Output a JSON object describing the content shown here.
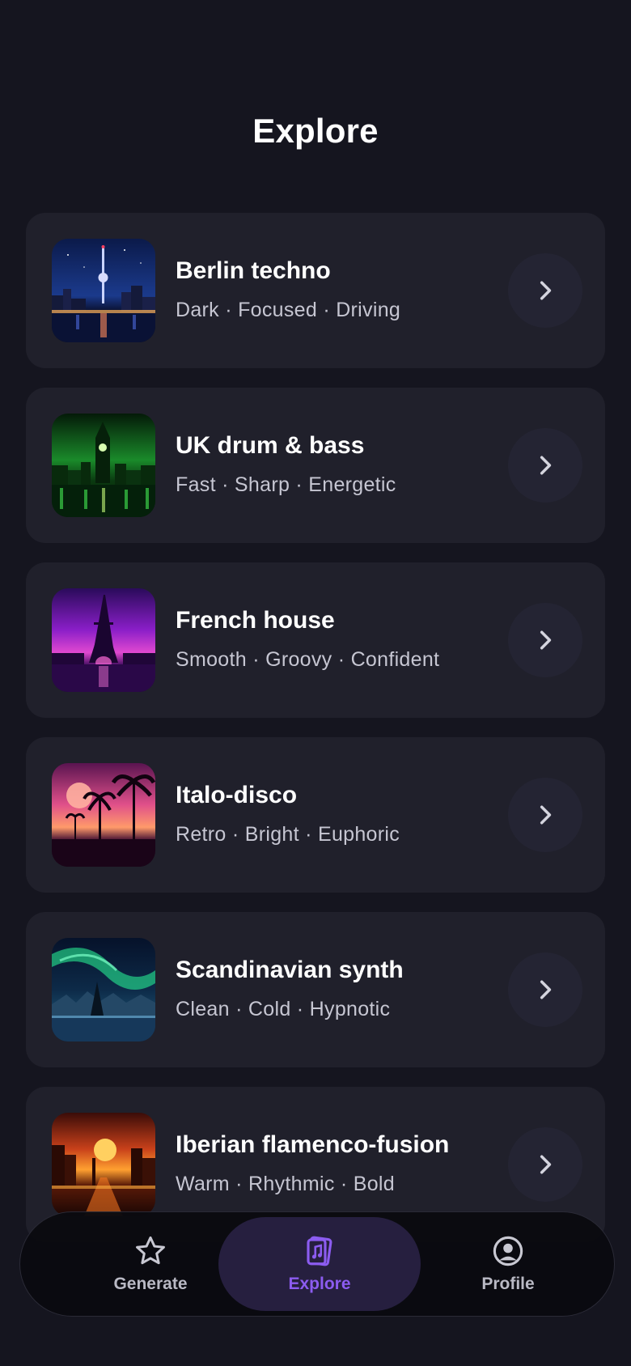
{
  "page": {
    "title": "Explore"
  },
  "genres": [
    {
      "name": "Berlin techno",
      "tags": "Dark · Focused · Driving",
      "image": "berlin-tv-tower-night"
    },
    {
      "name": "UK drum & bass",
      "tags": "Fast · Sharp · Energetic",
      "image": "london-big-ben-green"
    },
    {
      "name": "French house",
      "tags": "Smooth · Groovy · Confident",
      "image": "paris-eiffel-tower-purple"
    },
    {
      "name": "Italo-disco",
      "tags": "Retro · Bright · Euphoric",
      "image": "palm-trees-sunset-pink"
    },
    {
      "name": "Scandinavian synth",
      "tags": "Clean · Cold · Hypnotic",
      "image": "aurora-borealis-ice"
    },
    {
      "name": "Iberian flamenco-fusion",
      "tags": "Warm · Rhythmic · Bold",
      "image": "city-sunset-orange"
    }
  ],
  "tabbar": {
    "active": "Explore",
    "accent_color": "#8c5cf0",
    "tabs": [
      {
        "label": "Generate",
        "icon": "star-icon"
      },
      {
        "label": "Explore",
        "icon": "music-book-icon"
      },
      {
        "label": "Profile",
        "icon": "user-circle-icon"
      }
    ]
  }
}
